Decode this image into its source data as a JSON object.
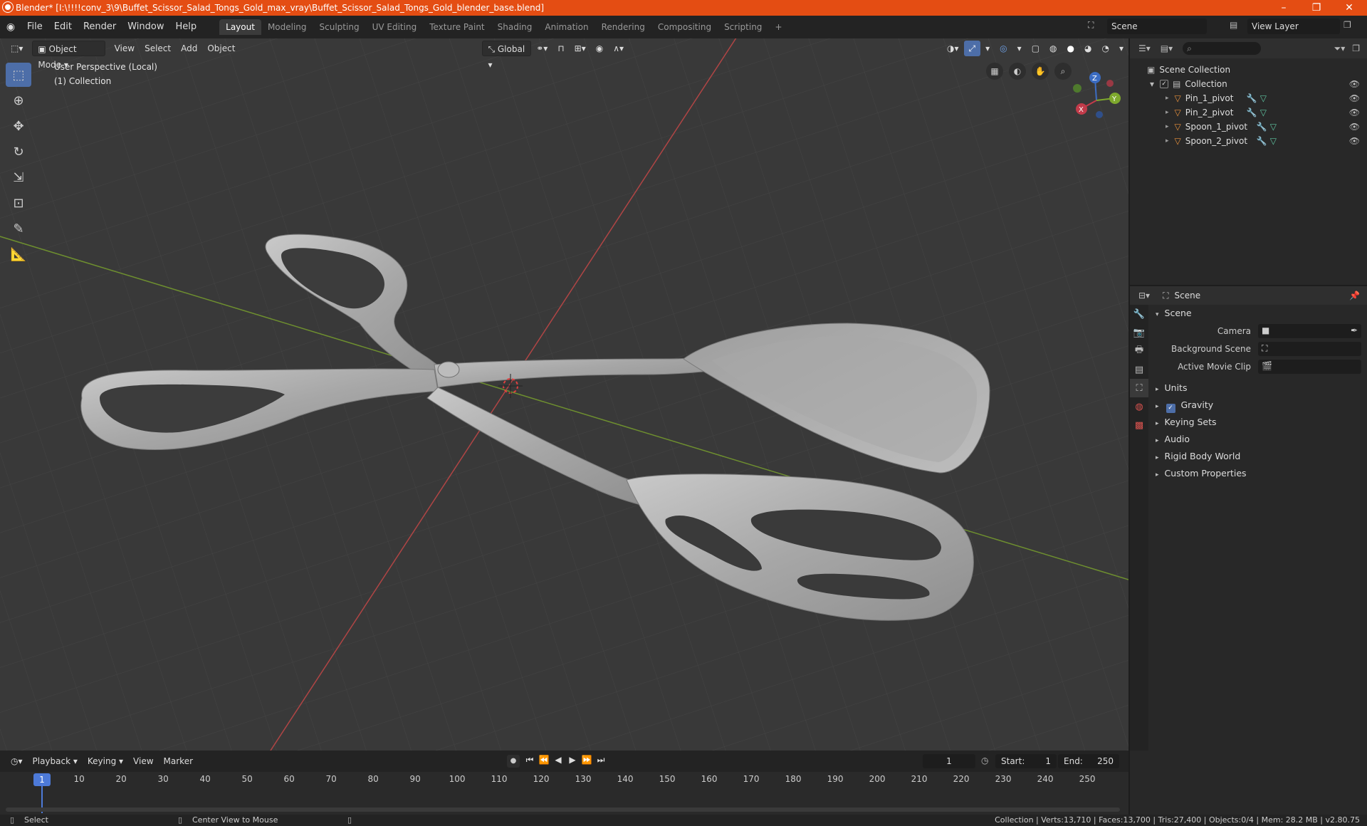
{
  "window": {
    "title": "Blender* [I:\\!!!!conv_3\\9\\Buffet_Scissor_Salad_Tongs_Gold_max_vray\\Buffet_Scissor_Salad_Tongs_Gold_blender_base.blend]",
    "minimize": "–",
    "restore": "❐",
    "close": "✕"
  },
  "menus": [
    "File",
    "Edit",
    "Render",
    "Window",
    "Help"
  ],
  "workspaces": [
    "Layout",
    "Modeling",
    "Sculpting",
    "UV Editing",
    "Texture Paint",
    "Shading",
    "Animation",
    "Rendering",
    "Compositing",
    "Scripting"
  ],
  "workspace_add": "+",
  "scene_name": "Scene",
  "view_layer": "View Layer",
  "viewport": {
    "mode": "Object Mode",
    "menus": [
      "View",
      "Select",
      "Add",
      "Object"
    ],
    "transform": "Global",
    "info_line1": "User Perspective (Local)",
    "info_line2": "(1) Collection",
    "gizmo": {
      "x": "X",
      "y": "Y",
      "z": "Z"
    }
  },
  "outliner": {
    "root": "Scene Collection",
    "collection": "Collection",
    "objects": [
      "Pin_1_pivot",
      "Pin_2_pivot",
      "Spoon_1_pivot",
      "Spoon_2_pivot"
    ]
  },
  "properties": {
    "header": "Scene",
    "section": "Scene",
    "fields": {
      "camera": "Camera",
      "background_scene": "Background Scene",
      "active_movie_clip": "Active Movie Clip"
    },
    "panels": {
      "units": "Units",
      "gravity": "Gravity",
      "keying_sets": "Keying Sets",
      "audio": "Audio",
      "rigid_body_world": "Rigid Body World",
      "custom_properties": "Custom Properties"
    }
  },
  "timeline": {
    "menus": [
      "Playback",
      "Keying",
      "View",
      "Marker"
    ],
    "current_frame": "1",
    "start_label": "Start:",
    "start": "1",
    "end_label": "End:",
    "end": "250",
    "ticks": [
      "1",
      "10",
      "20",
      "30",
      "40",
      "50",
      "60",
      "70",
      "80",
      "90",
      "100",
      "110",
      "120",
      "130",
      "140",
      "150",
      "160",
      "170",
      "180",
      "190",
      "200",
      "210",
      "220",
      "230",
      "240",
      "250"
    ]
  },
  "status": {
    "left": "Select",
    "middle": "Center View to Mouse",
    "right": "Collection | Verts:13,710 | Faces:13,700 | Tris:27,400 | Objects:0/4 | Mem: 28.2 MB | v2.80.75"
  }
}
